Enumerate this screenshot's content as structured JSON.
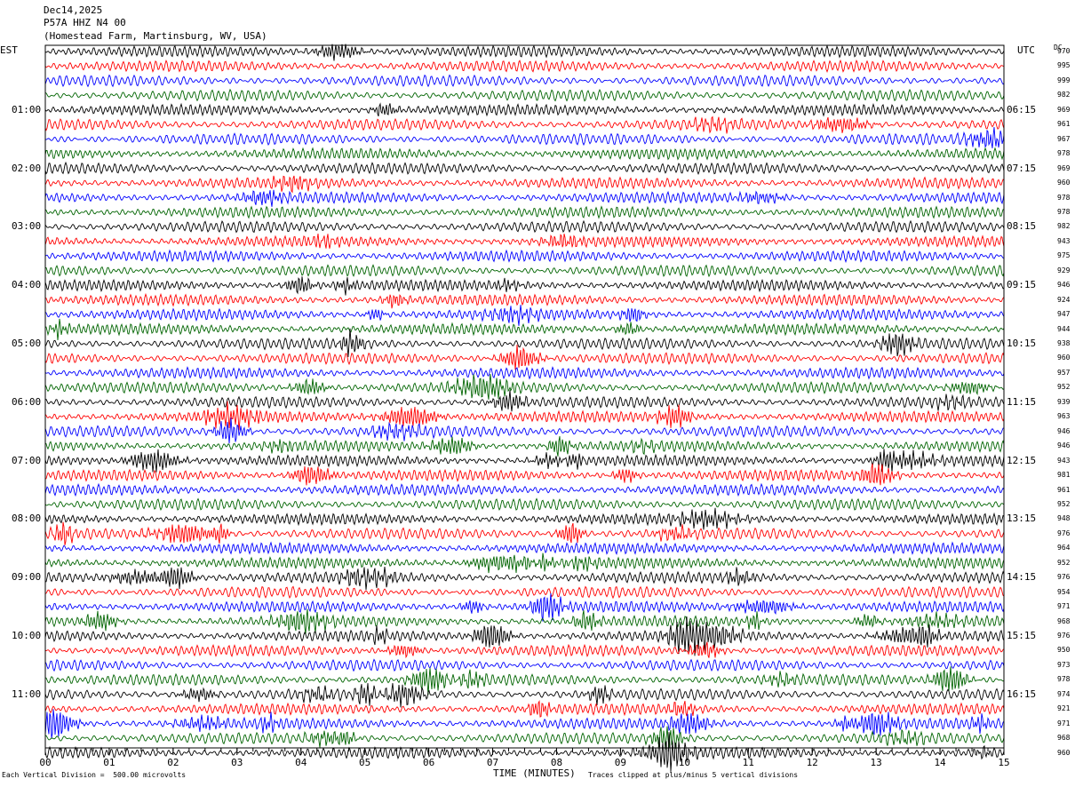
{
  "header": {
    "date": "Dec14,2025",
    "station": "P57A HHZ N4 00",
    "location": "(Homestead Farm, Martinsburg, WV, USA)"
  },
  "left_label": "EST",
  "right_label": "UTC",
  "dc_label": "DC",
  "footer": {
    "scale": "Each Vertical Division =  500.00 microvolts",
    "xlabel": "TIME (MINUTES)",
    "clip": "Traces clipped at plus/minus 5 vertical divisions"
  },
  "colors": [
    "#000000",
    "#ff0000",
    "#0000ff",
    "#006400"
  ],
  "chart_data": {
    "type": "line",
    "title": "P57A HHZ N4 00",
    "xlabel": "TIME (MINUTES)",
    "xlim": [
      0,
      15
    ],
    "x_ticks": [
      "00",
      "01",
      "02",
      "03",
      "04",
      "05",
      "06",
      "07",
      "08",
      "09",
      "10",
      "11",
      "12",
      "13",
      "14",
      "15"
    ],
    "left_hour_labels": [
      "01:00",
      "02:00",
      "03:00",
      "04:00",
      "05:00",
      "06:00",
      "07:00",
      "08:00",
      "09:00",
      "10:00",
      "11:00"
    ],
    "right_hour_labels": [
      "06:15",
      "07:15",
      "08:15",
      "09:15",
      "10:15",
      "11:15",
      "12:15",
      "13:15",
      "14:15",
      "15:15",
      "16:15"
    ],
    "trace_count": 48,
    "trace_minutes": 15,
    "dc_offsets": [
      970,
      995,
      999,
      982,
      969,
      961,
      967,
      978,
      969,
      960,
      978,
      978,
      982,
      943,
      975,
      929,
      946,
      924,
      947,
      944,
      938,
      960,
      957,
      952,
      939,
      963,
      946,
      946,
      943,
      981,
      961,
      952,
      948,
      976,
      964,
      952,
      976,
      954,
      971,
      968,
      976,
      950,
      973,
      978,
      974,
      921,
      971,
      968,
      960
    ]
  }
}
